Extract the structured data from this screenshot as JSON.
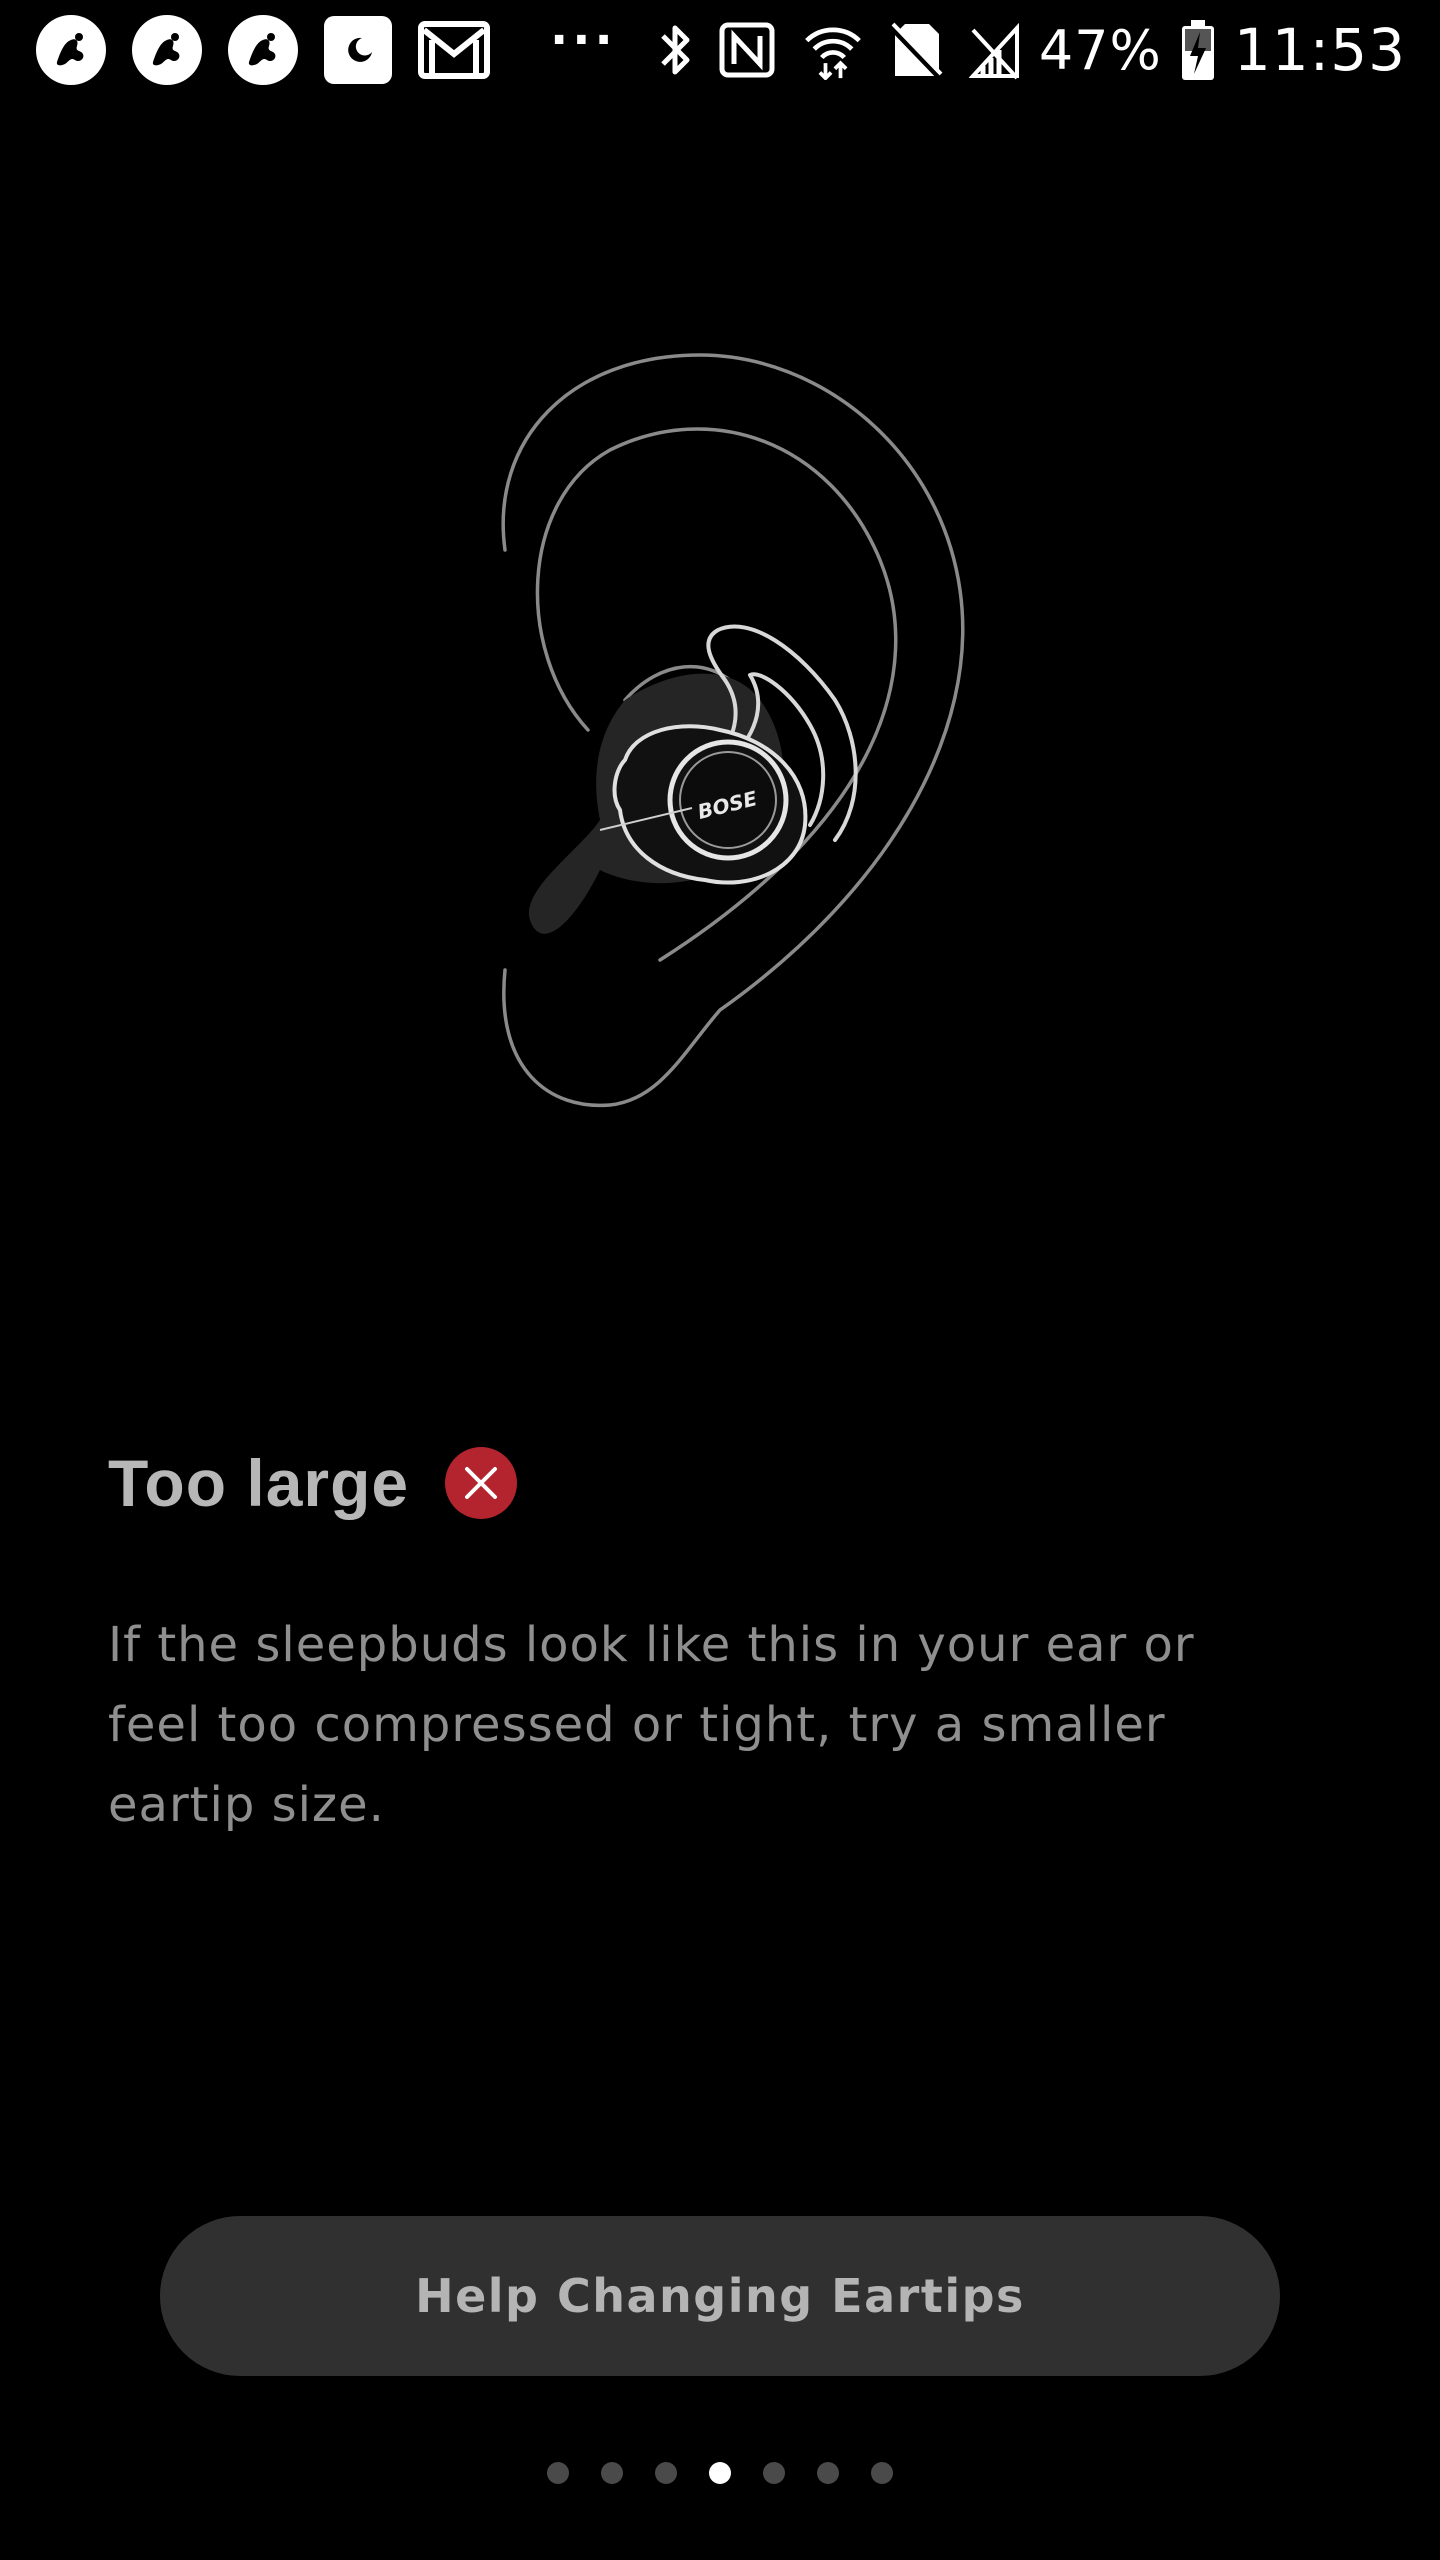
{
  "status_bar": {
    "notifications": [
      "bose-sleepbuds-app-icon",
      "bose-sleepbuds-app-icon",
      "bose-sleepbuds-app-icon",
      "do-not-disturb-moon-icon",
      "gmail-icon"
    ],
    "more_indicator": "···",
    "system_icons": [
      "bluetooth-icon",
      "nfc-icon",
      "wifi-icon",
      "no-sim-icon",
      "signal-icon"
    ],
    "battery_percent": "47%",
    "time": "11:53"
  },
  "illustration": {
    "brand_text": "BOSE",
    "subject": "ear-with-sleepbud-icon"
  },
  "content": {
    "title": "Too large",
    "status_icon": "x-circle-icon",
    "status_color": "#b3242e",
    "description": "If the sleepbuds look like this in your ear or feel too compressed or tight, try a smaller eartip size."
  },
  "help_button": {
    "label": "Help Changing Eartips"
  },
  "pagination": {
    "total_pages": 7,
    "current_page": 4
  }
}
